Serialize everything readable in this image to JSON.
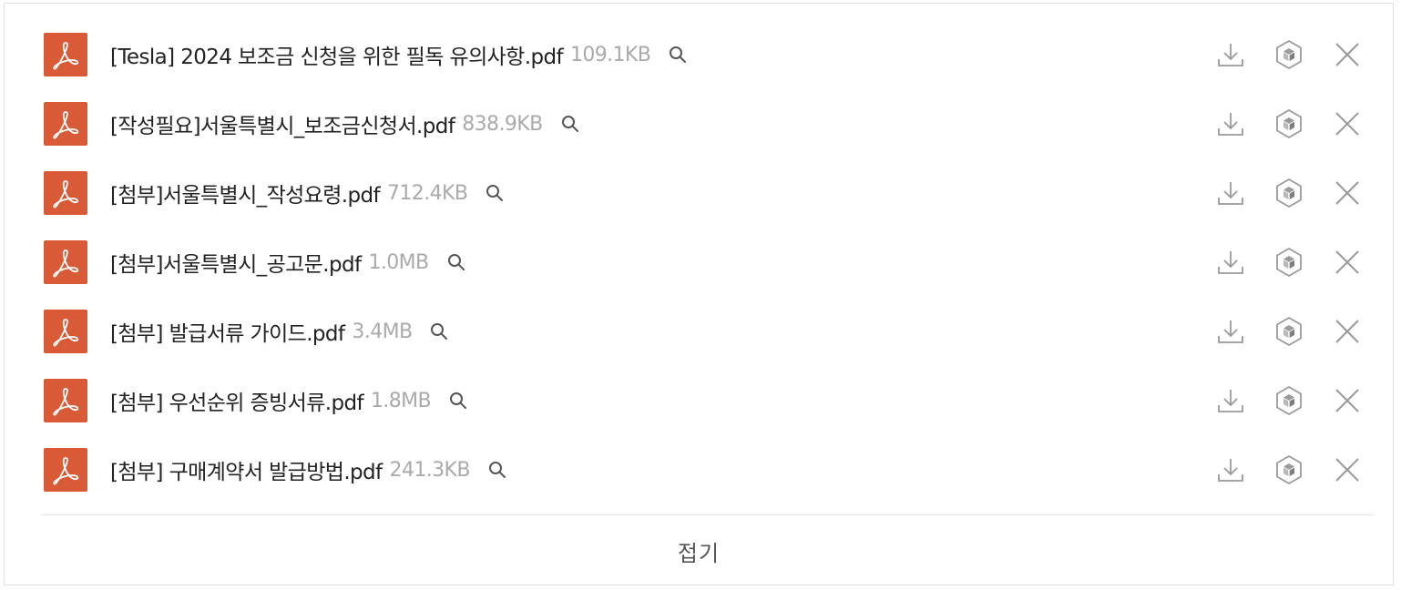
{
  "files": [
    {
      "name": "[Tesla] 2024 보조금 신청을 위한 필독 유의사항.pdf",
      "size": "109.1KB"
    },
    {
      "name": "[작성필요]서울특별시_보조금신청서.pdf",
      "size": "838.9KB"
    },
    {
      "name": "[첨부]서울특별시_작성요령.pdf",
      "size": "712.4KB"
    },
    {
      "name": "[첨부]서울특별시_공고문.pdf",
      "size": "1.0MB"
    },
    {
      "name": "[첨부] 발급서류 가이드.pdf",
      "size": "3.4MB"
    },
    {
      "name": "[첨부] 우선순위 증빙서류.pdf",
      "size": "1.8MB"
    },
    {
      "name": "[첨부] 구매계약서 발급방법.pdf",
      "size": "241.3KB"
    }
  ],
  "footer": {
    "collapse_label": "접기"
  },
  "colors": {
    "pdf_badge": "#d85a36",
    "icon": "#9a9a9a",
    "size_text": "#aaaaaa"
  },
  "icons": {
    "file": "pdf-icon",
    "preview": "search-icon",
    "download": "download-icon",
    "cube": "cube-icon",
    "remove": "close-icon"
  }
}
